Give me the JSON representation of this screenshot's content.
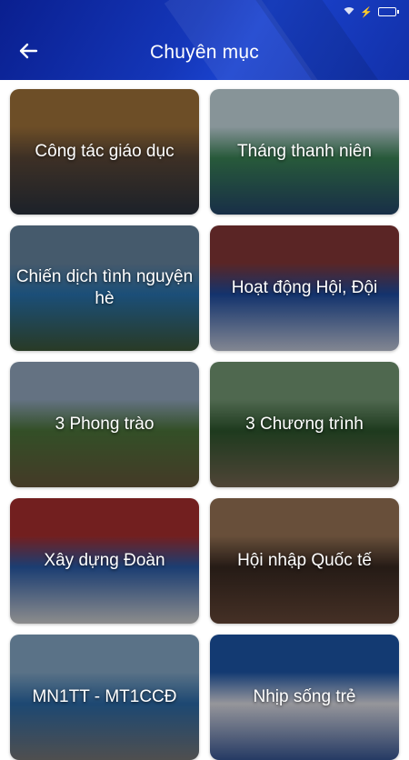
{
  "header": {
    "title": "Chuyên mục",
    "back_icon": "arrow-left-icon",
    "gradient": [
      "#0a1f8f",
      "#1a43cf"
    ]
  },
  "categories": [
    {
      "label": "Công tác giáo dục",
      "bg": [
        "#a8783c",
        "#5e4a3a",
        "#2c3440"
      ]
    },
    {
      "label": "Tháng thanh niên",
      "bg": [
        "#cfe3ea",
        "#3d8a5a",
        "#26486e"
      ]
    },
    {
      "label": "Chiến dịch tình nguyện hè",
      "bg": [
        "#6b8aa6",
        "#2a79b8",
        "#3f5a3a"
      ]
    },
    {
      "label": "Hoạt động Hội, Đội",
      "bg": [
        "#8a3a3a",
        "#1e4fa8",
        "#c9cfe0"
      ]
    },
    {
      "label": "3 Phong trào",
      "bg": [
        "#9ab0c8",
        "#4f7a3c",
        "#6a5a3c"
      ]
    },
    {
      "label": "3 Chương trình",
      "bg": [
        "#7aa07a",
        "#2f5a2f",
        "#7a6a55"
      ]
    },
    {
      "label": "Xây dựng Đoàn",
      "bg": [
        "#b03030",
        "#2a5fb0",
        "#d8d8d8"
      ]
    },
    {
      "label": "Hội nhập Quốc tế",
      "bg": [
        "#a07a5a",
        "#3a2a22",
        "#6a4a3a"
      ]
    },
    {
      "label": "MN1TT - MT1CCĐ",
      "bg": [
        "#8ab0d0",
        "#2d6fb0",
        "#7a7a7a"
      ]
    },
    {
      "label": "Nhịp sống trẻ",
      "bg": [
        "#1e5ab0",
        "#e6e6ee",
        "#3a5a9a"
      ]
    }
  ]
}
